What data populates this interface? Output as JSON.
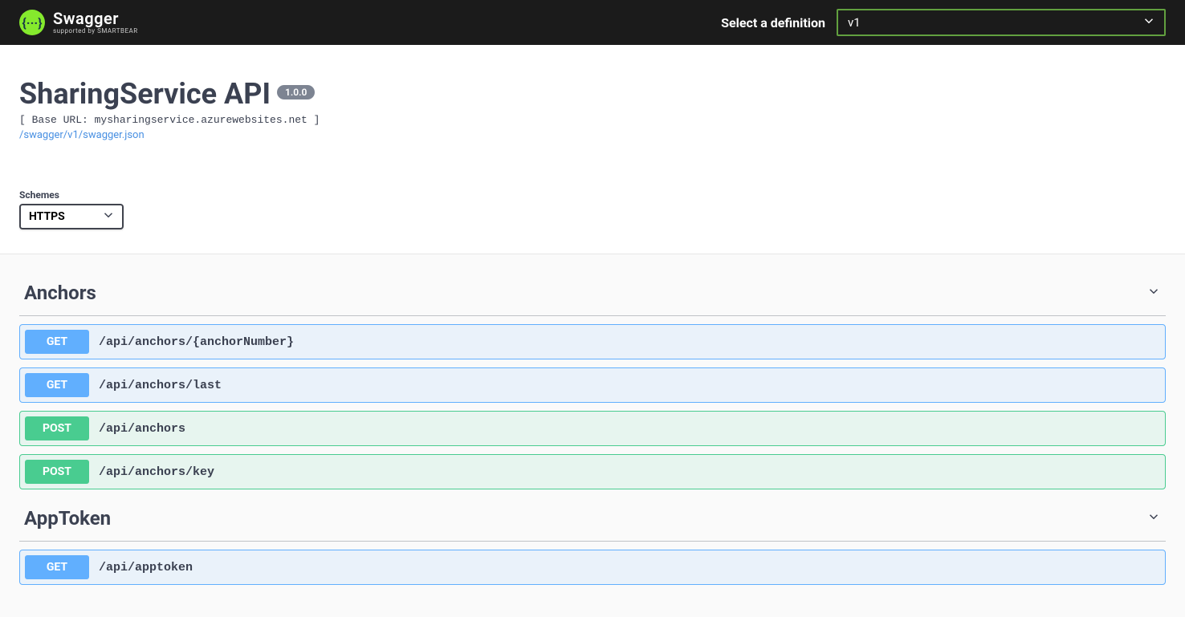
{
  "topbar": {
    "brand": "Swagger",
    "sub_brand": "supported by SMARTBEAR",
    "logo_glyph": "{···}",
    "select_label": "Select a definition",
    "definition_selected": "v1"
  },
  "info": {
    "title": "SharingService API",
    "version": "1.0.0",
    "base_url_line": "[ Base URL: mysharingservice.azurewebsites.net ]",
    "swagger_json_link": "/swagger/v1/swagger.json"
  },
  "schemes": {
    "label": "Schemes",
    "selected": "HTTPS"
  },
  "tags": [
    {
      "name": "Anchors",
      "ops": [
        {
          "method": "GET",
          "path": "/api/anchors/{anchorNumber}"
        },
        {
          "method": "GET",
          "path": "/api/anchors/last"
        },
        {
          "method": "POST",
          "path": "/api/anchors"
        },
        {
          "method": "POST",
          "path": "/api/anchors/key"
        }
      ]
    },
    {
      "name": "AppToken",
      "ops": [
        {
          "method": "GET",
          "path": "/api/apptoken"
        }
      ]
    }
  ],
  "colors": {
    "get": "#61affe",
    "post": "#49cc90",
    "accent": "#85ea2d"
  }
}
